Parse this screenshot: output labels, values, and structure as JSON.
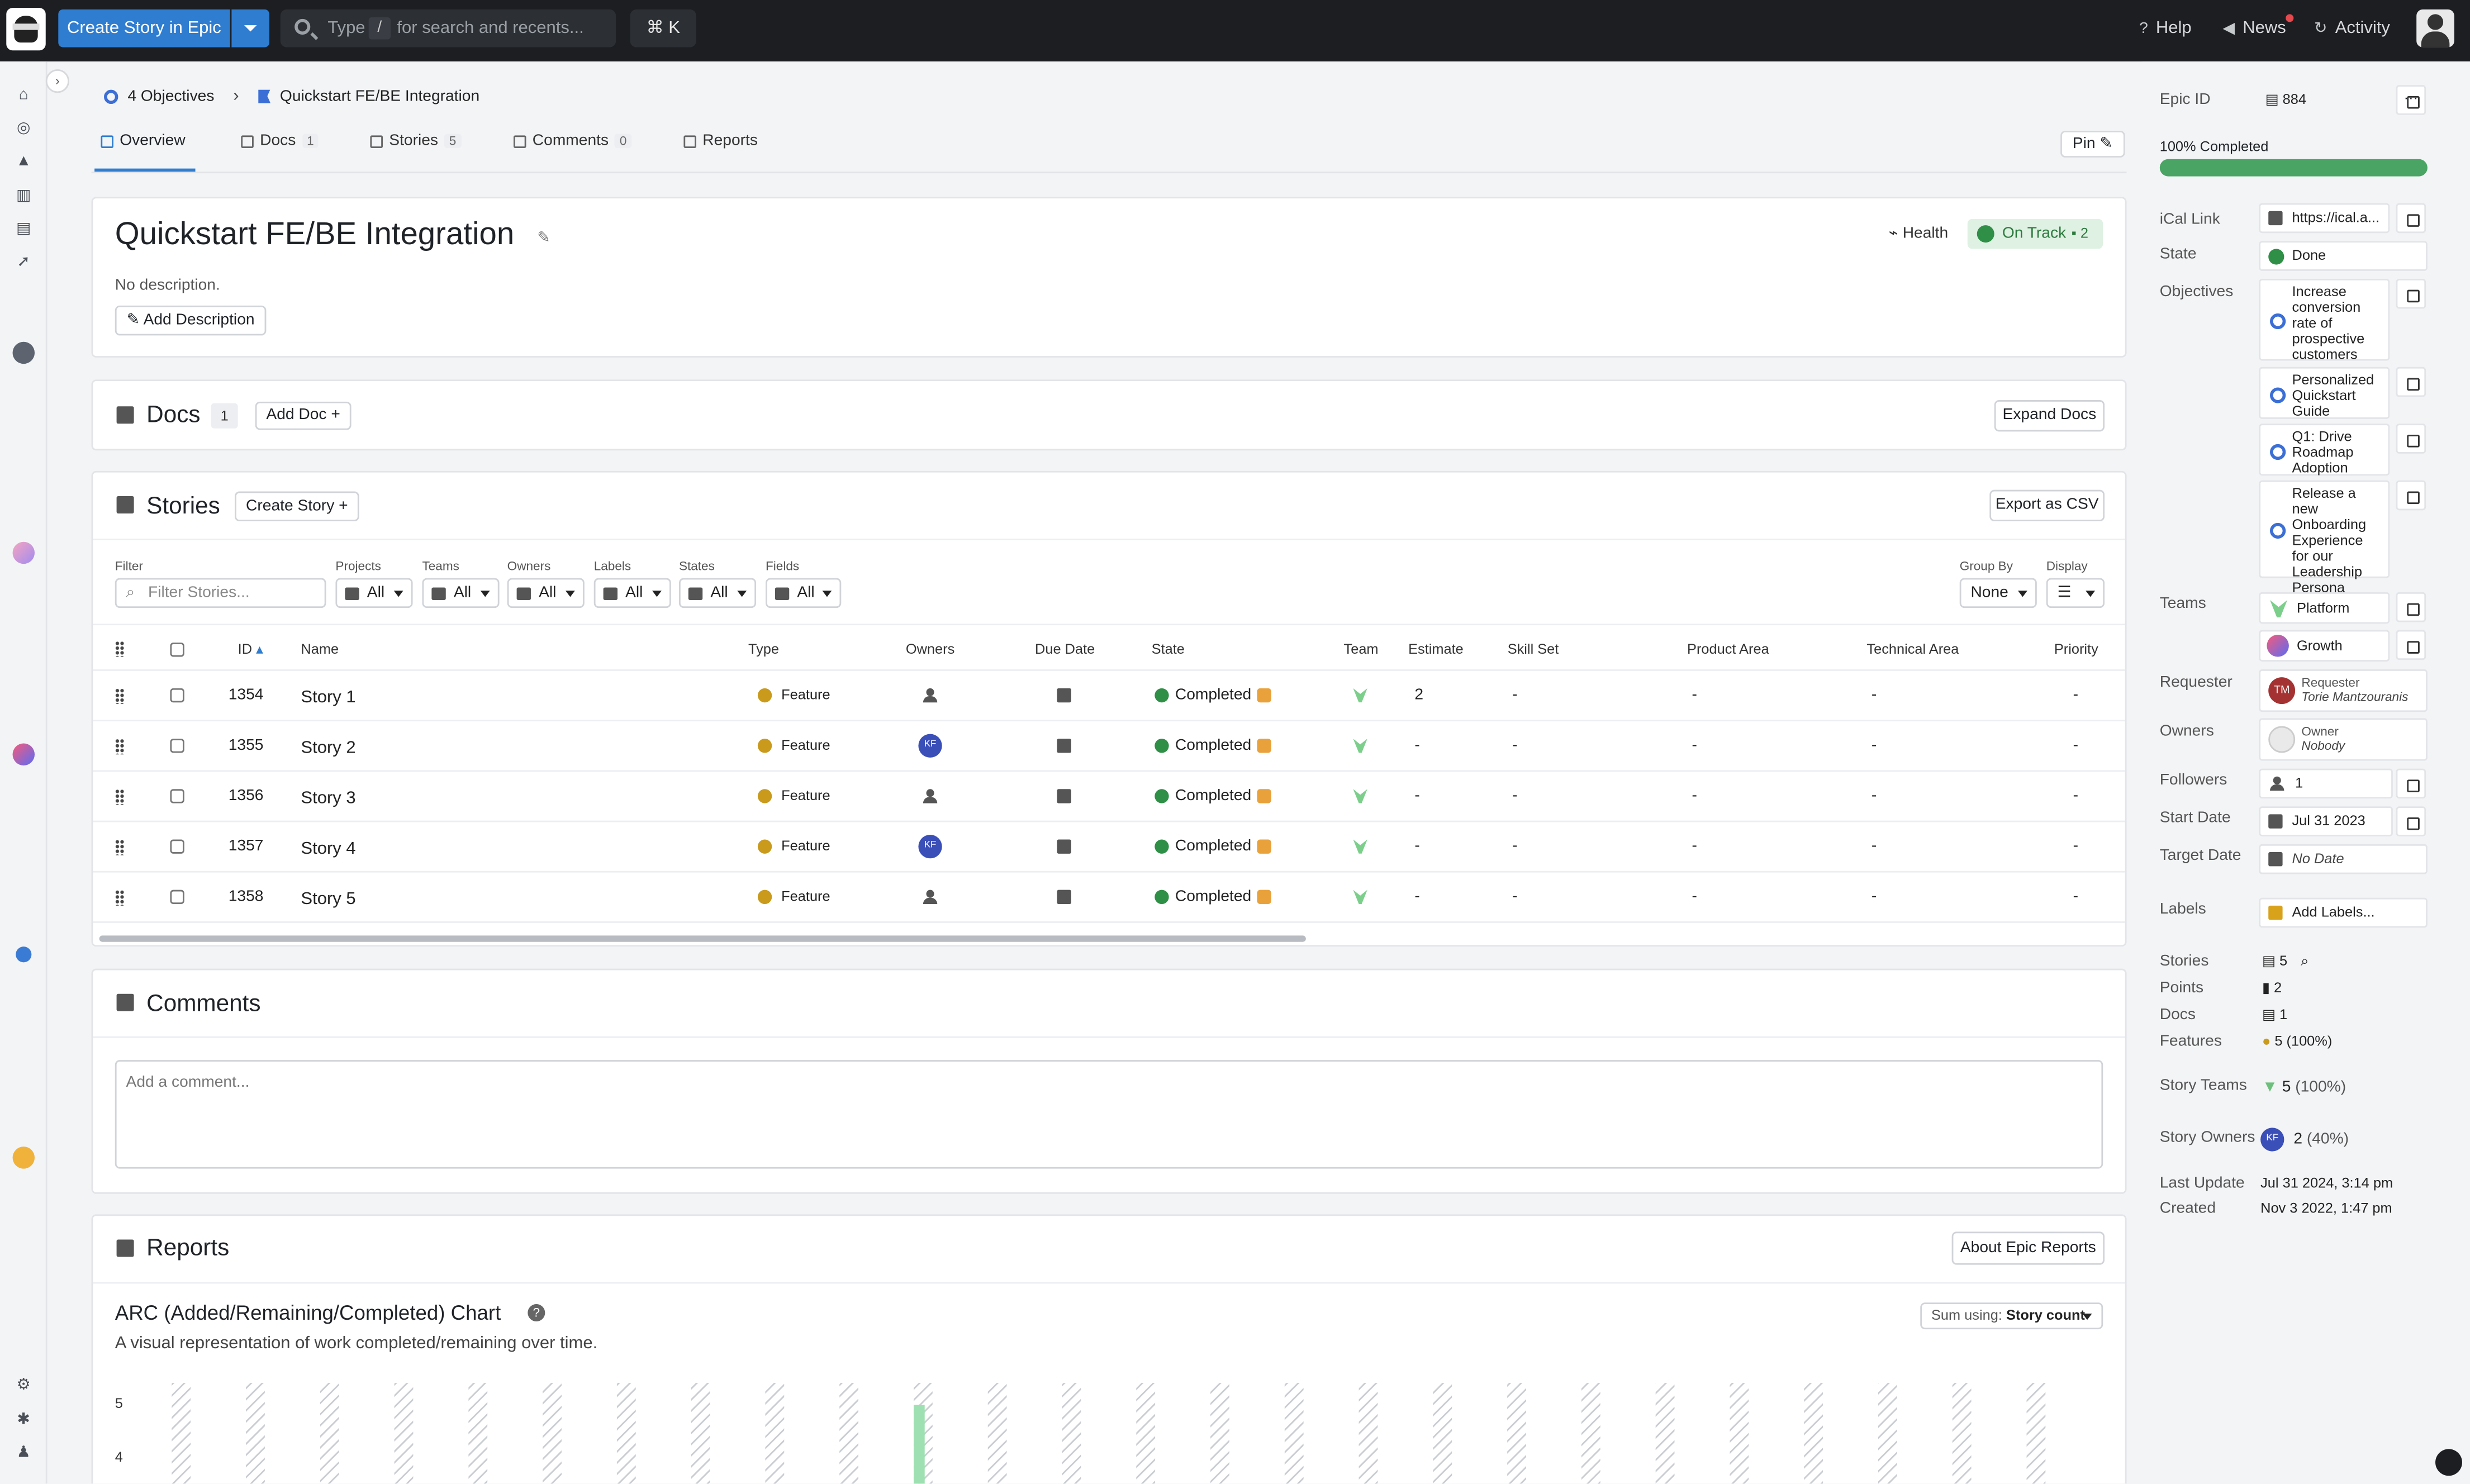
{
  "topbar": {
    "create_label": "Create Story in Epic",
    "search_prefix": "Type",
    "search_key": "/",
    "search_suffix": "for search and recents...",
    "cmdk": "⌘ K",
    "help": "Help",
    "news": "News",
    "activity": "Activity"
  },
  "breadcrumb": {
    "objectives": "4 Objectives",
    "epic": "Quickstart FE/BE Integration"
  },
  "tabs": [
    {
      "label": "Overview",
      "count": ""
    },
    {
      "label": "Docs",
      "count": "1"
    },
    {
      "label": "Stories",
      "count": "5"
    },
    {
      "label": "Comments",
      "count": "0"
    },
    {
      "label": "Reports",
      "count": ""
    }
  ],
  "pin_label": "Pin",
  "overview": {
    "title": "Quickstart FE/BE Integration",
    "description": "No description.",
    "add_description": "Add Description",
    "health_label": "Health",
    "health_status": "On Track",
    "health_comments": "2"
  },
  "docs": {
    "title": "Docs",
    "count": "1",
    "add_doc": "Add Doc",
    "expand": "Expand Docs"
  },
  "stories": {
    "title": "Stories",
    "create": "Create Story",
    "export": "Export as CSV",
    "filter_label": "Filter",
    "filter_placeholder": "Filter Stories...",
    "filters": [
      {
        "label": "Projects",
        "value": "All"
      },
      {
        "label": "Teams",
        "value": "All"
      },
      {
        "label": "Owners",
        "value": "All"
      },
      {
        "label": "Labels",
        "value": "All"
      },
      {
        "label": "States",
        "value": "All"
      },
      {
        "label": "Fields",
        "value": "All"
      }
    ],
    "group_by_label": "Group By",
    "group_by_value": "None",
    "display_label": "Display",
    "columns": [
      "ID",
      "Name",
      "Type",
      "Owners",
      "Due Date",
      "State",
      "Team",
      "Estimate",
      "Skill Set",
      "Product Area",
      "Technical Area",
      "Priority"
    ],
    "rows": [
      {
        "id": "1354",
        "name": "Story 1",
        "type": "Feature",
        "owner": "",
        "state": "Completed",
        "estimate": "2",
        "skill": "-",
        "product": "-",
        "technical": "-",
        "priority": "-"
      },
      {
        "id": "1355",
        "name": "Story 2",
        "type": "Feature",
        "owner": "KF",
        "state": "Completed",
        "estimate": "-",
        "skill": "-",
        "product": "-",
        "technical": "-",
        "priority": "-"
      },
      {
        "id": "1356",
        "name": "Story 3",
        "type": "Feature",
        "owner": "",
        "state": "Completed",
        "estimate": "-",
        "skill": "-",
        "product": "-",
        "technical": "-",
        "priority": "-"
      },
      {
        "id": "1357",
        "name": "Story 4",
        "type": "Feature",
        "owner": "KF",
        "state": "Completed",
        "estimate": "-",
        "skill": "-",
        "product": "-",
        "technical": "-",
        "priority": "-"
      },
      {
        "id": "1358",
        "name": "Story 5",
        "type": "Feature",
        "owner": "",
        "state": "Completed",
        "estimate": "-",
        "skill": "-",
        "product": "-",
        "technical": "-",
        "priority": "-"
      }
    ]
  },
  "comments": {
    "title": "Comments",
    "placeholder": "Add a comment..."
  },
  "reports": {
    "title": "Reports",
    "about": "About Epic Reports",
    "chart_title": "ARC (Added/Remaining/Completed) Chart",
    "chart_subtitle": "A visual representation of work completed/remaining over time.",
    "sum_prefix": "Sum using:",
    "sum_value": "Story count"
  },
  "chart_data": {
    "type": "bar",
    "title": "ARC (Added/Remaining/Completed) Chart",
    "subtitle": "A visual representation of work completed/remaining over time.",
    "yticks": [
      "5",
      "4"
    ],
    "bar_count": 26,
    "highlight_index": 10,
    "highlight_value": 5
  },
  "sidebar": {
    "epic_id_label": "Epic ID",
    "epic_id": "884",
    "progress_text": "100% Completed",
    "progress_fraction": 1.0,
    "ical_label": "iCal Link",
    "ical_value": "https://ical.a...",
    "state_label": "State",
    "state_value": "Done",
    "objectives_label": "Objectives",
    "objectives": [
      "Increase conversion rate of prospective customers",
      "Personalized Quickstart Guide",
      "Q1: Drive Roadmap Adoption",
      "Release a new Onboarding Experience for our Leadership Persona"
    ],
    "teams_label": "Teams",
    "teams": [
      "Platform",
      "Growth"
    ],
    "requester_label": "Requester",
    "requester_role": "Requester",
    "requester_name": "Torie Mantzouranis",
    "requester_initials": "TM",
    "owners_label": "Owners",
    "owner_role": "Owner",
    "owner_name": "Nobody",
    "followers_label": "Followers",
    "followers_value": "1",
    "start_label": "Start Date",
    "start_value": "Jul 31 2023",
    "target_label": "Target Date",
    "target_value": "No Date",
    "labels_label": "Labels",
    "labels_value": "Add Labels...",
    "stories_label": "Stories",
    "stories_value": "5",
    "points_label": "Points",
    "points_value": "2",
    "docs_label": "Docs",
    "docs_value": "1",
    "features_label": "Features",
    "features_value": "5 (100%)",
    "story_teams_label": "Story Teams",
    "story_teams_value": "5",
    "story_teams_pct": "(100%)",
    "story_owners_label": "Story Owners",
    "story_owners_value": "2",
    "story_owners_pct": "(40%)",
    "story_owners_initials": "KF",
    "last_update_label": "Last Update",
    "last_update_value": "Jul 31 2024, 3:14 pm",
    "created_label": "Created",
    "created_value": "Nov 3 2022, 1:47 pm"
  }
}
